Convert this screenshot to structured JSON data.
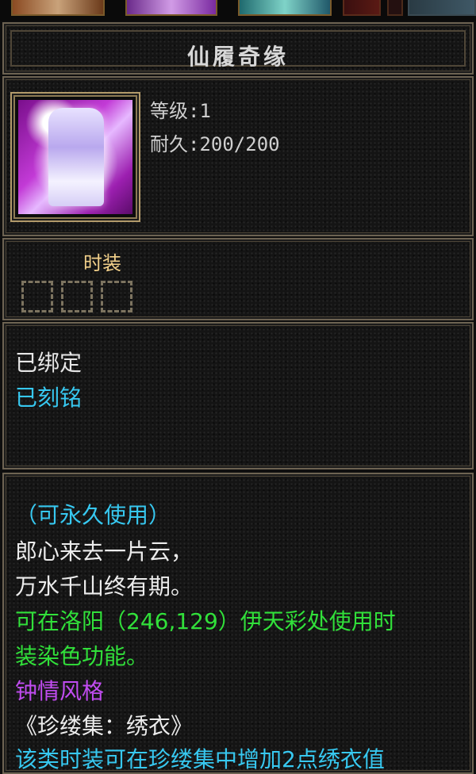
{
  "item": {
    "name": "仙履奇缘",
    "level": "等级:1",
    "durability": "耐久:200/200",
    "icon": "white-purple-robe-icon"
  },
  "category": {
    "label": "时装",
    "sockets": 3
  },
  "status": {
    "bound": "已绑定",
    "engraved": "已刻铭"
  },
  "description": {
    "lines": [
      "（可永久使用）",
      "郎心来去一片云，",
      "万水千山终有期。",
      "可在洛阳（246,129）伊天彩处使用时",
      "装染色功能。",
      "钟情风格",
      "《珍缕集：绣衣》",
      "该类时装可在珍缕集中增加2点绣衣值"
    ]
  },
  "colors": {
    "cyan": "#37c8f0",
    "green": "#31e03a",
    "purple": "#c04cf0",
    "gold": "#f2d08a",
    "border": "#6d6352"
  }
}
